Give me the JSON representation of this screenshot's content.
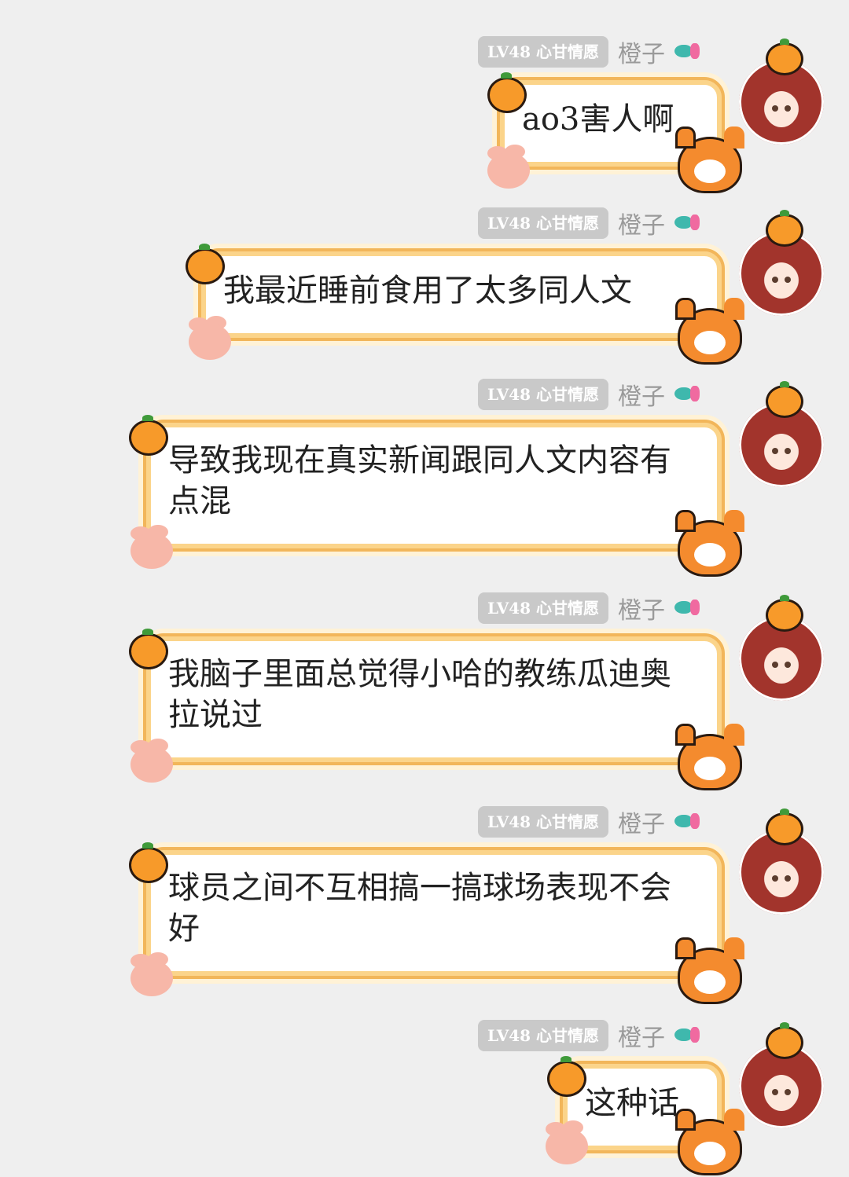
{
  "messages": [
    {
      "level": "LV48 心甘情愿",
      "sender": "橙子",
      "text": "ao3害人啊"
    },
    {
      "level": "LV48 心甘情愿",
      "sender": "橙子",
      "text": "我最近睡前食用了太多同人文"
    },
    {
      "level": "LV48 心甘情愿",
      "sender": "橙子",
      "text": "导致我现在真实新闻跟同人文内容有点混"
    },
    {
      "level": "LV48 心甘情愿",
      "sender": "橙子",
      "text": "我脑子里面总觉得小哈的教练瓜迪奥拉说过"
    },
    {
      "level": "LV48 心甘情愿",
      "sender": "橙子",
      "text": "球员之间不互相搞一搞球场表现不会好"
    },
    {
      "level": "LV48 心甘情愿",
      "sender": "橙子",
      "text": "这种话"
    }
  ]
}
